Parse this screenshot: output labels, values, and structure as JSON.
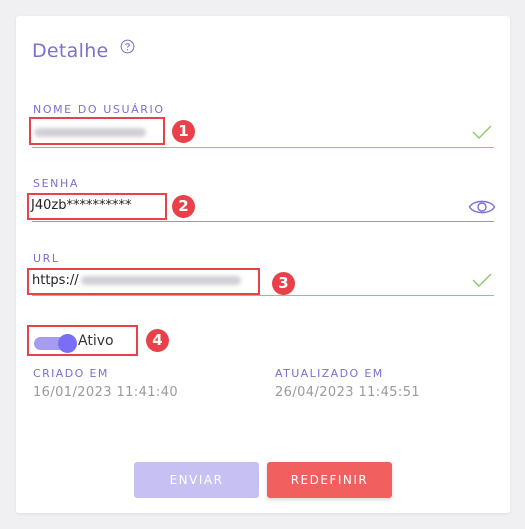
{
  "card": {
    "title": "Detalhe"
  },
  "fields": {
    "username": {
      "label": "NOME DO USUÁRIO",
      "value_obscured": true
    },
    "password": {
      "label": "SENHA",
      "value": "J40zb**********"
    },
    "url": {
      "label": "URL",
      "value_prefix": "https://"
    }
  },
  "toggle": {
    "label": "Ativo",
    "checked": true
  },
  "meta": {
    "created_label": "CRIADO EM",
    "created_value": "16/01/2023 11:41:40",
    "updated_label": "ATUALIZADO EM",
    "updated_value": "26/04/2023 11:45:51"
  },
  "buttons": {
    "send": "ENVIAR",
    "reset": "REDEFINIR"
  },
  "annotations": [
    "1",
    "2",
    "3",
    "4"
  ],
  "colors": {
    "accent": "#7b6fd8",
    "valid_line": "#8fc86a",
    "annotation": "#e8414a",
    "reset_button": "#f25f5f",
    "send_button_disabled": "#c7c0f2"
  },
  "icons": {
    "help": "help-circle-icon",
    "valid": "check-icon",
    "reveal": "eye-icon"
  }
}
